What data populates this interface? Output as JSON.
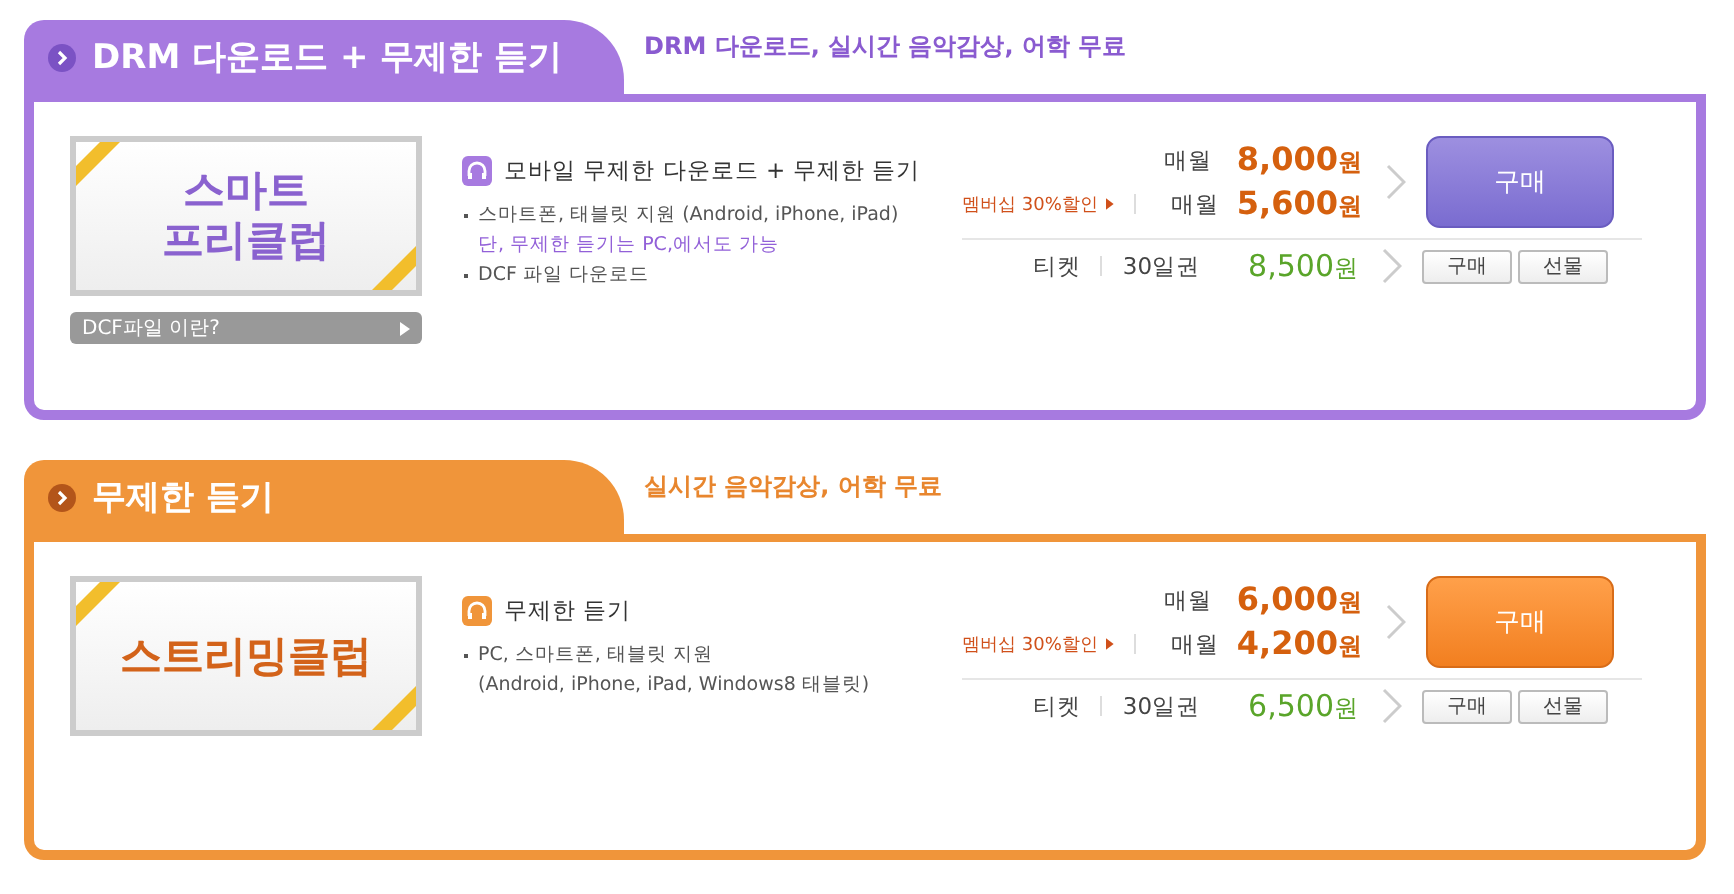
{
  "sections": [
    {
      "kind": "drm",
      "title": "DRM 다운로드 + 무제한 듣기",
      "subtitle": "DRM 다운로드, 실시간 음악감상, 어학 무료",
      "banner_lines": [
        "스마트",
        "프리클럽"
      ],
      "info_button": "DCF파일 이란?",
      "heading": "모바일 무제한 다운로드 + 무제한 듣기",
      "features": [
        {
          "kind": "bullet",
          "text": "스마트폰, 태블릿 지원 (Android, iPhone, iPad)"
        },
        {
          "kind": "highlight",
          "text": "단, 무제한 듣기는 PC,에서도 가능"
        },
        {
          "kind": "bullet",
          "text": "DCF 파일 다운로드"
        }
      ],
      "monthly": [
        {
          "label": "매월",
          "price": "8,000",
          "unit": "원"
        },
        {
          "discount": "멤버십 30%할인",
          "label": "매월",
          "price": "5,600",
          "unit": "원"
        }
      ],
      "buy_button": "구매",
      "ticket": {
        "label": "티켓",
        "period": "30일권",
        "price": "8,500",
        "unit": "원",
        "buttons": [
          "구매",
          "선물"
        ]
      }
    },
    {
      "kind": "streaming",
      "title": "무제한 듣기",
      "subtitle": "실시간 음악감상, 어학 무료",
      "banner_lines": [
        "스트리밍클럽"
      ],
      "heading": "무제한 듣기",
      "features": [
        {
          "kind": "bullet",
          "text": "PC, 스마트폰, 태블릿 지원"
        },
        {
          "kind": "plain",
          "text": "(Android, iPhone, iPad, Windows8 태블릿)"
        }
      ],
      "monthly": [
        {
          "label": "매월",
          "price": "6,000",
          "unit": "원"
        },
        {
          "discount": "멤버십 30%할인",
          "label": "매월",
          "price": "4,200",
          "unit": "원"
        }
      ],
      "buy_button": "구매",
      "ticket": {
        "label": "티켓",
        "period": "30일권",
        "price": "6,500",
        "unit": "원",
        "buttons": [
          "구매",
          "선물"
        ]
      }
    }
  ]
}
